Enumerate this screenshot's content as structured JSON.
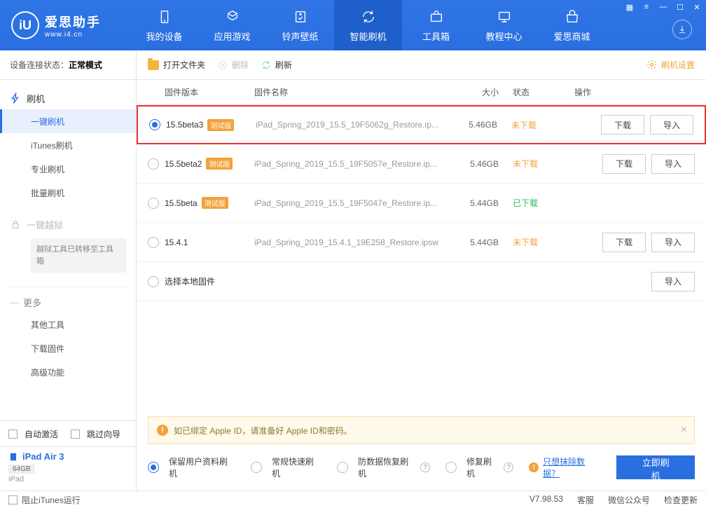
{
  "window_controls": {
    "grid": "▦",
    "list": "≡",
    "min": "—",
    "max": "☐",
    "close": "✕"
  },
  "logo": {
    "mark": "iU",
    "title": "爱思助手",
    "url": "www.i4.cn"
  },
  "nav": [
    {
      "key": "device",
      "label": "我的设备"
    },
    {
      "key": "apps",
      "label": "应用游戏"
    },
    {
      "key": "wall",
      "label": "铃声壁纸"
    },
    {
      "key": "flash",
      "label": "智能刷机",
      "active": true
    },
    {
      "key": "toolbox",
      "label": "工具箱"
    },
    {
      "key": "tutorial",
      "label": "教程中心"
    },
    {
      "key": "store",
      "label": "爱思商城"
    }
  ],
  "sidebar": {
    "conn_label": "设备连接状态：",
    "conn_value": "正常模式",
    "groups": [
      {
        "title": "刷机",
        "icon": "flash",
        "items": [
          {
            "label": "一键刷机",
            "active": true
          },
          {
            "label": "iTunes刷机"
          },
          {
            "label": "专业刷机"
          },
          {
            "label": "批量刷机"
          }
        ]
      },
      {
        "title": "一键越狱",
        "icon": "lock",
        "disabled": true,
        "note": "越狱工具已转移至工具箱"
      }
    ],
    "more_title": "更多",
    "more_items": [
      {
        "label": "其他工具"
      },
      {
        "label": "下载固件"
      },
      {
        "label": "高级功能"
      }
    ],
    "auto_activate": "自动激活",
    "skip_guide": "跳过向导",
    "device": {
      "name": "iPad Air 3",
      "storage": "64GB",
      "type": "iPad"
    },
    "block_itunes": "阻止iTunes运行"
  },
  "toolbar": {
    "open_folder": "打开文件夹",
    "delete": "删除",
    "refresh": "刷新",
    "settings": "刷机设置"
  },
  "columns": {
    "version": "固件版本",
    "name": "固件名称",
    "size": "大小",
    "status": "状态",
    "ops": "操作"
  },
  "status_text": {
    "not_downloaded": "未下载",
    "downloaded": "已下载"
  },
  "beta_tag": "测试版",
  "ops": {
    "download": "下载",
    "import": "导入"
  },
  "firmware": [
    {
      "version": "15.5beta3",
      "beta": true,
      "name": "iPad_Spring_2019_15.5_19F5062g_Restore.ip...",
      "size": "5.46GB",
      "status": "not",
      "selected": true,
      "highlight": true,
      "download": true
    },
    {
      "version": "15.5beta2",
      "beta": true,
      "name": "iPad_Spring_2019_15.5_19F5057e_Restore.ip...",
      "size": "5.46GB",
      "status": "not",
      "download": true
    },
    {
      "version": "15.5beta",
      "beta": true,
      "name": "iPad_Spring_2019_15.5_19F5047e_Restore.ip...",
      "size": "5.44GB",
      "status": "done"
    },
    {
      "version": "15.4.1",
      "beta": false,
      "name": "iPad_Spring_2019_15.4.1_19E258_Restore.ipsw",
      "size": "5.44GB",
      "status": "not",
      "download": true
    }
  ],
  "local_select": "选择本地固件",
  "notice": "如已绑定 Apple ID，请准备好 Apple ID和密码。",
  "flash_options": [
    {
      "label": "保留用户资料刷机",
      "selected": true
    },
    {
      "label": "常规快速刷机"
    },
    {
      "label": "防数据恢复刷机",
      "help": true
    },
    {
      "label": "修复刷机",
      "help": true
    }
  ],
  "erase_link": "只想抹除数据？",
  "flash_now": "立即刷机",
  "statusbar": {
    "version": "V7.98.53",
    "cs": "客服",
    "wechat": "微信公众号",
    "update": "检查更新"
  }
}
